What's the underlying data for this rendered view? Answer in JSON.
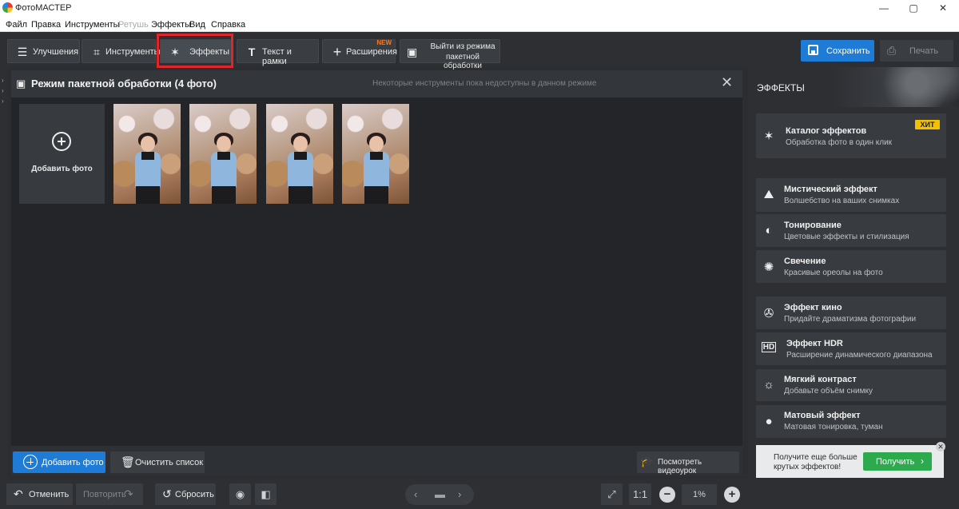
{
  "window": {
    "title": "ФотоМАСТЕР",
    "controls": {
      "minimize": "—",
      "maximize": "▢",
      "close": "✕"
    }
  },
  "menu": [
    "Файл",
    "Правка",
    "Инструменты",
    "Ретушь",
    "Эффекты",
    "Вид",
    "Справка"
  ],
  "toolbar": {
    "tabs": [
      {
        "label": "Улучшения",
        "icon": "sliders-icon"
      },
      {
        "label": "Инструменты",
        "icon": "crop-icon"
      },
      {
        "label": "Эффекты",
        "icon": "magic-wand-icon",
        "active": true
      },
      {
        "label": "Текст и рамки",
        "icon": "text-icon"
      },
      {
        "label": "Расширения",
        "icon": "plus-icon",
        "badge": "NEW"
      }
    ],
    "exit_batch": {
      "line1": "Выйти из режима",
      "line2": "пакетной обработки"
    },
    "save": "Сохранить",
    "print": "Печать"
  },
  "main": {
    "title": "Режим пакетной обработки (4 фото)",
    "notice": "Некоторые инструменты пока недоступны в данном режиме",
    "add_tile": "Добавить фото",
    "photo_count": 4,
    "add_photo_button": "Добавить фото",
    "clear_list_button": "Очистить список",
    "video_button": "Посмотреть видеоурок"
  },
  "bottom": {
    "undo": "Отменить",
    "redo": "Повторить",
    "reset": "Сбросить",
    "ratio": "1:1",
    "zoom": "1%"
  },
  "panel": {
    "title": "ЭФФЕКТЫ",
    "catalog": {
      "title": "Каталог эффектов",
      "subtitle": "Обработка фото в один клик",
      "badge": "ХИТ"
    },
    "items": [
      {
        "title": "Мистический эффект",
        "subtitle": "Волшебство на ваших снимках"
      },
      {
        "title": "Тонирование",
        "subtitle": "Цветовые эффекты и стилизация"
      },
      {
        "title": "Свечение",
        "subtitle": "Красивые ореолы на фото"
      },
      {
        "title": "Эффект кино",
        "subtitle": "Придайте драматизма фотографии"
      },
      {
        "title": "Эффект HDR",
        "subtitle": "Расширение динамического диапазона"
      },
      {
        "title": "Мягкий контраст",
        "subtitle": "Добавьте объём снимку"
      },
      {
        "title": "Матовый эффект",
        "subtitle": "Матовая тонировка, туман"
      }
    ],
    "promo": {
      "line1": "Получите еще больше",
      "line2": "крутых эффектов!",
      "button": "Получить"
    }
  },
  "colors": {
    "accent": "#1e7bd6",
    "highlight": "#e0262b",
    "green": "#2eaa4e",
    "hit": "#f2c200"
  }
}
